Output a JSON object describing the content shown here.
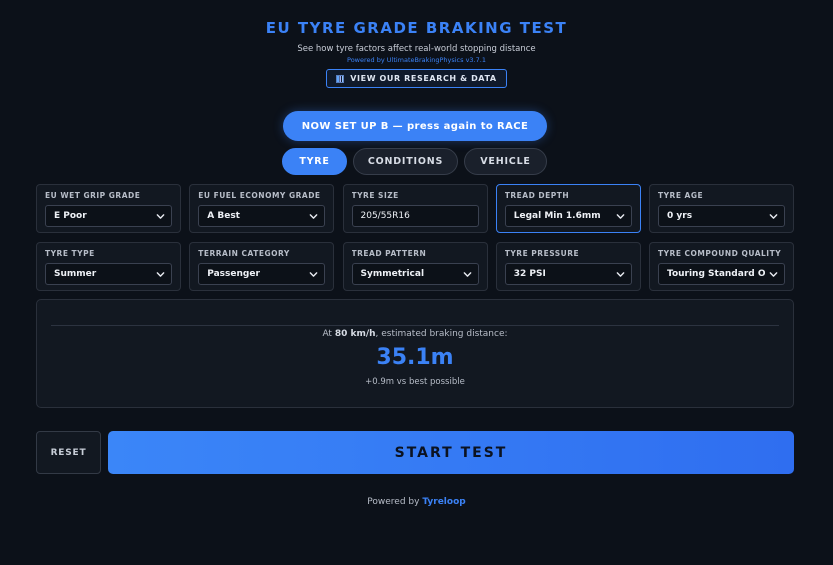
{
  "header": {
    "title": "EU TYRE GRADE BRAKING TEST",
    "subtitle": "See how tyre factors affect real-world stopping distance",
    "powered_small": "Powered by UltimateBrakingPhysics v3.7.1",
    "research_button": "VIEW OUR RESEARCH & DATA"
  },
  "setup_button": "NOW SET UP B — press again to RACE",
  "tabs": [
    {
      "label": "TYRE",
      "active": true
    },
    {
      "label": "CONDITIONS",
      "active": false
    },
    {
      "label": "VEHICLE",
      "active": false
    }
  ],
  "fields": [
    {
      "label": "EU WET GRIP GRADE",
      "value": "E Poor",
      "type": "select"
    },
    {
      "label": "EU FUEL ECONOMY GRADE",
      "value": "A Best",
      "type": "select"
    },
    {
      "label": "TYRE SIZE",
      "value": "205/55R16",
      "type": "text"
    },
    {
      "label": "TREAD DEPTH",
      "value": "Legal Min 1.6mm",
      "type": "select"
    },
    {
      "label": "TYRE AGE",
      "value": "0 yrs",
      "type": "select"
    },
    {
      "label": "TYRE TYPE",
      "value": "Summer",
      "type": "select"
    },
    {
      "label": "TERRAIN CATEGORY",
      "value": "Passenger",
      "type": "select"
    },
    {
      "label": "TREAD PATTERN",
      "value": "Symmetrical",
      "type": "select"
    },
    {
      "label": "TYRE PRESSURE",
      "value": "32 PSI",
      "type": "select"
    },
    {
      "label": "TYRE COMPOUND QUALITY",
      "value": "Touring Standard OE",
      "type": "select"
    }
  ],
  "result": {
    "prefix": "At ",
    "speed": "80 km/h",
    "suffix": ", estimated braking distance:",
    "distance": "35.1m",
    "delta": "+0.9m vs best possible"
  },
  "reset_label": "RESET",
  "start_label": "START TEST",
  "footer": {
    "prefix": "Powered by ",
    "brand": "Tyreloop"
  },
  "colors": {
    "accent": "#3b82f6",
    "background": "#0c1119",
    "panel": "#121821"
  },
  "icons": {
    "research": "bar-chart-icon",
    "select": "chevron-down-icon"
  }
}
